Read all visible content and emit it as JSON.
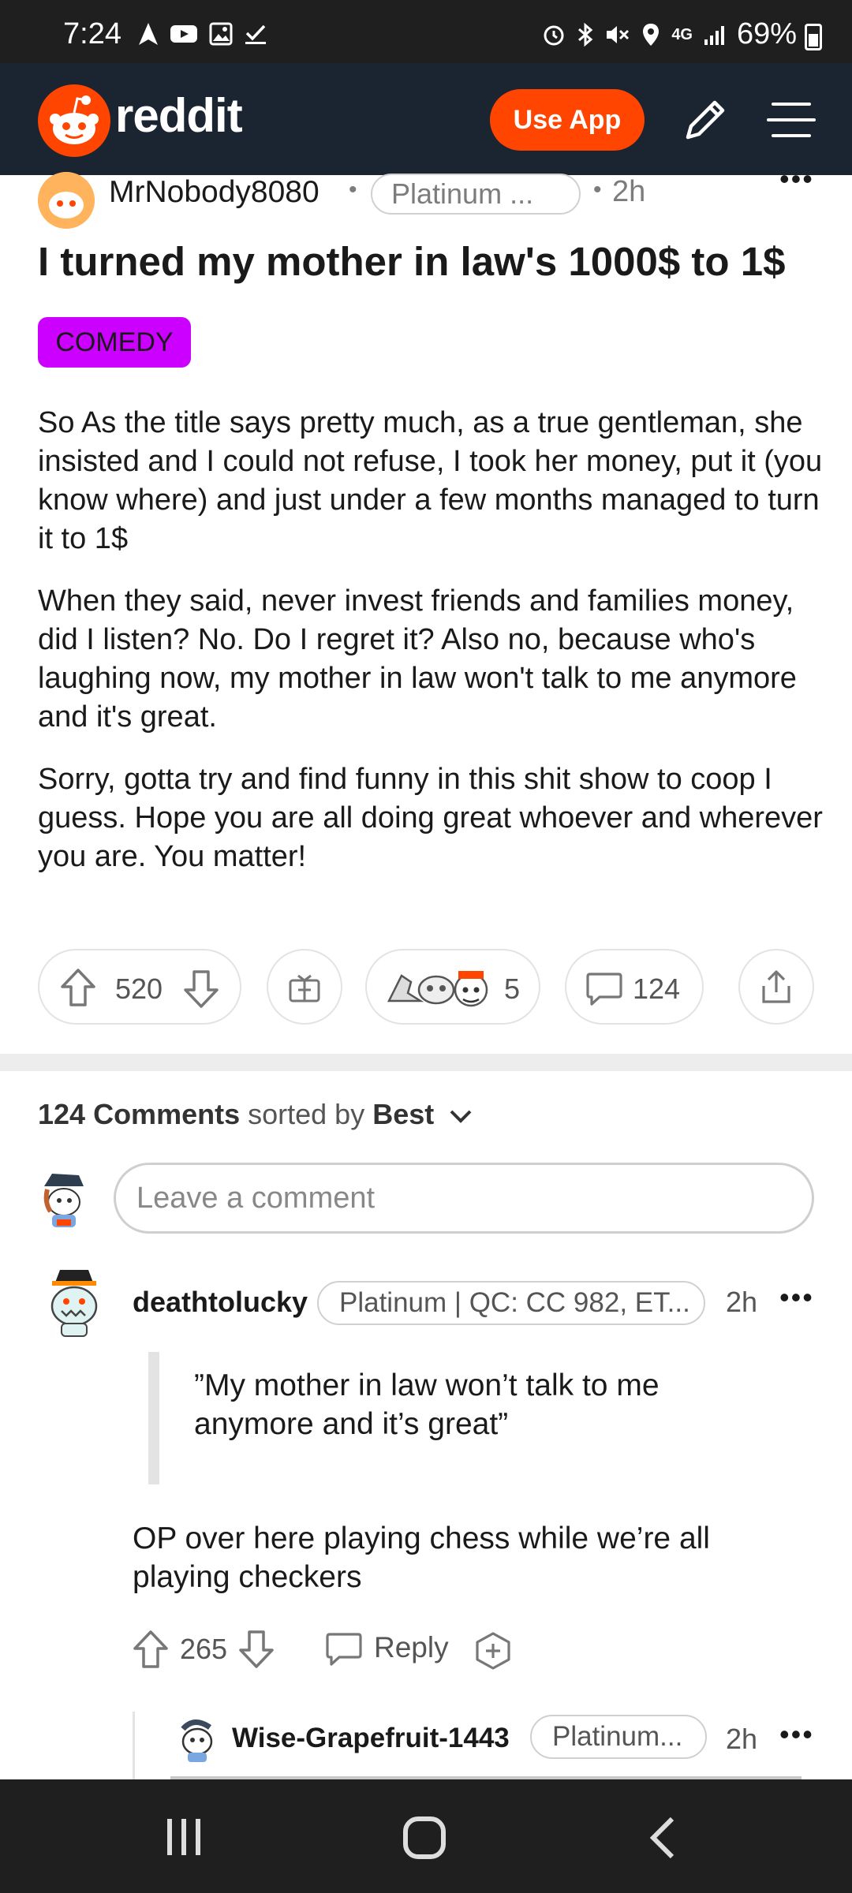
{
  "status_bar": {
    "time": "7:24",
    "battery": "69%",
    "network": "4G"
  },
  "header": {
    "logo_text": "reddit",
    "use_app_label": "Use App",
    "brand_color": "#ff4500"
  },
  "post": {
    "author": "MrNobody8080",
    "author_flair": "Platinum ...",
    "age": "2h",
    "title": "I turned my mother in law's 1000$ to 1$",
    "flair": "COMEDY",
    "flair_color": "#cc00ff",
    "body": [
      "So As the title says pretty much, as a true gentleman, she insisted and I could not refuse, I took her money, put it (you know where) and just under a few months managed to turn it to 1$",
      "When they said, never invest friends and families money, did I listen? No. Do I regret it? Also no, because who's laughing now, my mother in law won't talk to me anymore and it's great.",
      "Sorry, gotta try and find funny in this shit show to coop I guess. Hope you are all doing great whoever and wherever you are. You matter!"
    ],
    "score": "520",
    "awards_count": "5",
    "comments_count": "124"
  },
  "comments_section": {
    "count_label": "124 Comments",
    "sorted_by_label": "sorted by",
    "sort_value": "Best",
    "input_placeholder": "Leave a comment"
  },
  "comments": [
    {
      "author": "deathtolucky",
      "flair": "Platinum | QC: CC 982, ET...",
      "age": "2h",
      "quote": "”My mother in law won’t talk to me anymore and it’s great”",
      "body": "OP over here playing chess while we’re all playing checkers",
      "score": "265",
      "reply_label": "Reply"
    },
    {
      "author": "Wise-Grapefruit-1443",
      "flair": "Platinum...",
      "age": "2h"
    }
  ]
}
